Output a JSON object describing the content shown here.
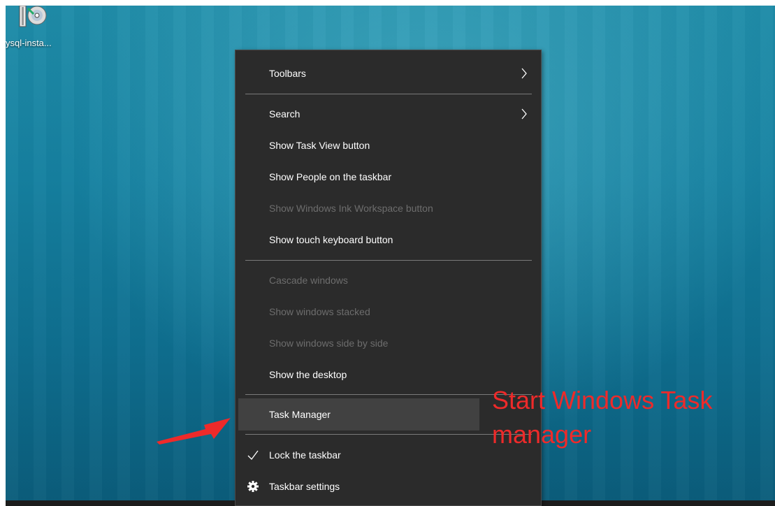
{
  "desktop": {
    "icon_label": "ysql-insta..."
  },
  "menu": {
    "items": [
      {
        "label": "Toolbars",
        "state": "enabled",
        "submenu": true
      },
      {
        "label": "Search",
        "state": "enabled",
        "submenu": true
      },
      {
        "label": "Show Task View button",
        "state": "enabled"
      },
      {
        "label": "Show People on the taskbar",
        "state": "enabled"
      },
      {
        "label": "Show Windows Ink Workspace button",
        "state": "disabled"
      },
      {
        "label": "Show touch keyboard button",
        "state": "enabled"
      },
      {
        "label": "Cascade windows",
        "state": "disabled"
      },
      {
        "label": "Show windows stacked",
        "state": "disabled"
      },
      {
        "label": "Show windows side by side",
        "state": "disabled"
      },
      {
        "label": "Show the desktop",
        "state": "enabled"
      },
      {
        "label": "Task Manager",
        "state": "highlighted"
      },
      {
        "label": "Lock the taskbar",
        "state": "enabled",
        "checked": true,
        "icon": "checkmark-icon"
      },
      {
        "label": "Taskbar settings",
        "state": "enabled",
        "icon": "gear-icon"
      }
    ]
  },
  "annotation": {
    "line1": "Start Windows Task",
    "line2": "manager",
    "color": "#ee2a2a"
  },
  "colors": {
    "menu_bg": "#2b2b2b",
    "menu_text": "#ffffff",
    "menu_disabled_text": "#6d6d6d",
    "menu_highlight": "#414141"
  }
}
